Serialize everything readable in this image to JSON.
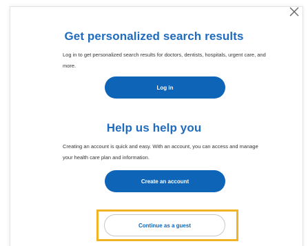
{
  "modal": {
    "close_label": "×",
    "section1": {
      "heading": "Get personalized search results",
      "body": "Log in to get personalized search results for doctors, dentists, hospitals, urgent care, and more.",
      "button": "Log in"
    },
    "section2": {
      "heading": "Help us help you",
      "body": "Creating an account is quick and easy. With an account, you can access and manage your health care plan and information.",
      "button": "Create an account"
    },
    "guest_button": "Continue as a guest"
  },
  "colors": {
    "heading": "#1f6bbd",
    "primary_button": "#0e65b8",
    "highlight": "#f0b323"
  }
}
